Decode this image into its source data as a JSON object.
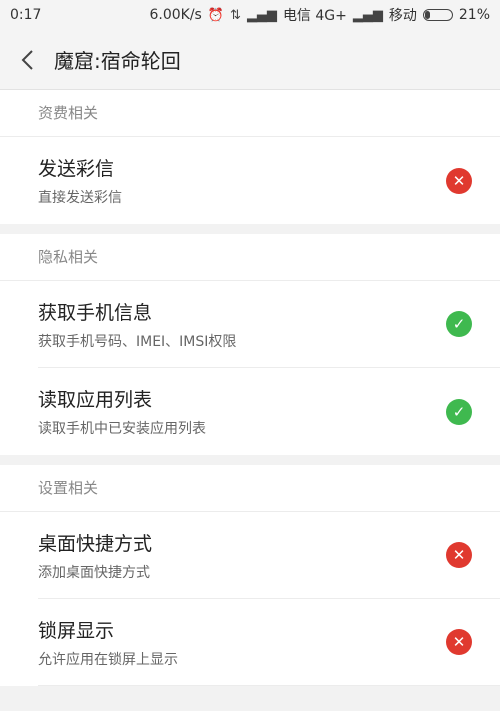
{
  "statusbar": {
    "time": "0:17",
    "speed": "6.00K/s",
    "carrier1": "电信 4G+",
    "carrier2": "移动",
    "battery": "21%"
  },
  "titlebar": {
    "title": "魔窟:宿命轮回"
  },
  "sections": [
    {
      "header": "资费相关",
      "items": [
        {
          "title": "发送彩信",
          "subtitle": "直接发送彩信",
          "status": "deny"
        }
      ]
    },
    {
      "header": "隐私相关",
      "items": [
        {
          "title": "获取手机信息",
          "subtitle": "获取手机号码、IMEI、IMSI权限",
          "status": "allow"
        },
        {
          "title": "读取应用列表",
          "subtitle": "读取手机中已安装应用列表",
          "status": "allow"
        }
      ]
    },
    {
      "header": "设置相关",
      "items": [
        {
          "title": "桌面快捷方式",
          "subtitle": "添加桌面快捷方式",
          "status": "deny"
        },
        {
          "title": "锁屏显示",
          "subtitle": "允许应用在锁屏上显示",
          "status": "deny"
        }
      ]
    }
  ],
  "colors": {
    "deny": "#e0392f",
    "allow": "#3fb94f"
  }
}
